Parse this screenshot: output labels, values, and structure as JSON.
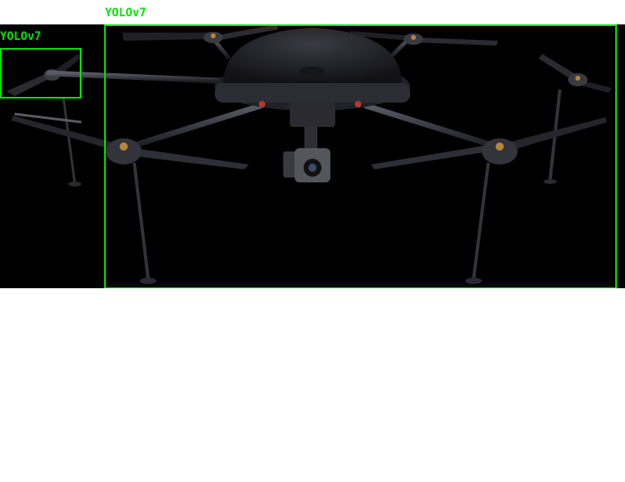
{
  "detections": [
    {
      "label": "YOLOv7",
      "object": "drone-rotor-arm"
    },
    {
      "label": "YOLOv7",
      "object": "drone"
    }
  ],
  "colors": {
    "box": "#00e600",
    "background": "#000000",
    "canvas": "#ffffff"
  }
}
